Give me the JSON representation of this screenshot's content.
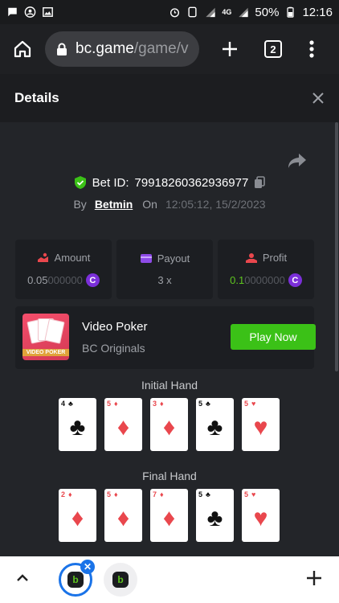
{
  "status_bar": {
    "battery": "50%",
    "time": "12:16",
    "network": "4G"
  },
  "browser": {
    "url_host": "bc.game",
    "url_path": "/game/v",
    "tab_count": "2"
  },
  "details": {
    "title": "Details"
  },
  "bet": {
    "bet_id_label": "Bet ID:",
    "bet_id": "79918260362936977",
    "by_label": "By",
    "user": "Betmin",
    "on_label": "On",
    "timestamp": "12:05:12, 15/2/2023"
  },
  "stats": {
    "amount_label": "Amount",
    "amount_main": "0.05",
    "amount_dim": "000000",
    "payout_label": "Payout",
    "payout_value": "3 x",
    "profit_label": "Profit",
    "profit_main": "0.1",
    "profit_dim": "0000000",
    "coin_symbol": "C"
  },
  "game": {
    "thumb_text": "VIDEO POKER",
    "name": "Video Poker",
    "provider": "BC Originals",
    "play_label": "Play Now"
  },
  "initial_hand": {
    "label": "Initial Hand",
    "cards": [
      {
        "rank": "4",
        "suit": "♣",
        "color": "black"
      },
      {
        "rank": "5",
        "suit": "♦",
        "color": "red"
      },
      {
        "rank": "3",
        "suit": "♦",
        "color": "red"
      },
      {
        "rank": "5",
        "suit": "♣",
        "color": "black"
      },
      {
        "rank": "5",
        "suit": "♥",
        "color": "red"
      }
    ]
  },
  "final_hand": {
    "label": "Final Hand",
    "cards": [
      {
        "rank": "2",
        "suit": "♦",
        "color": "red"
      },
      {
        "rank": "5",
        "suit": "♦",
        "color": "red"
      },
      {
        "rank": "7",
        "suit": "♦",
        "color": "red"
      },
      {
        "rank": "5",
        "suit": "♣",
        "color": "black"
      },
      {
        "rank": "5",
        "suit": "♥",
        "color": "red"
      }
    ]
  },
  "colors": {
    "accent_green": "#3bc117",
    "coin_purple": "#7b2fd9",
    "card_red": "#e9474d"
  }
}
